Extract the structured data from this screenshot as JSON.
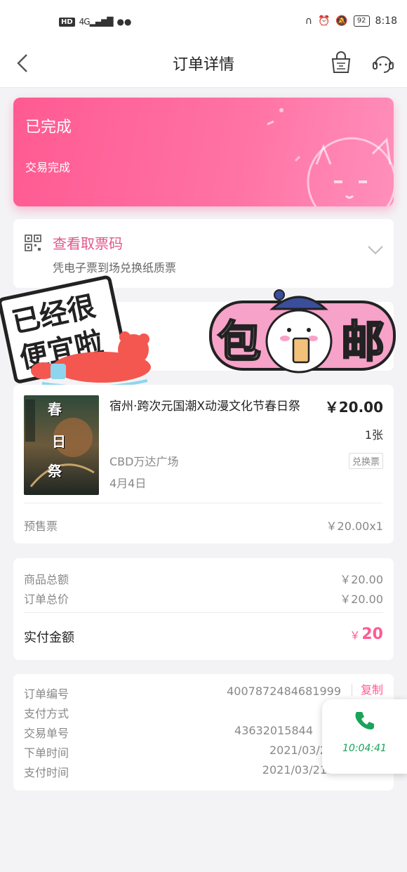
{
  "status_bar": {
    "hd": "HD",
    "network": "4G",
    "battery": "92",
    "time": "8:18"
  },
  "nav": {
    "title": "订单详情"
  },
  "order_status": {
    "title": "已完成",
    "subtitle": "交易完成"
  },
  "ticket": {
    "title": "查看取票码",
    "description": "凭电子票到场兑换纸质票"
  },
  "promo": {
    "left_sticker_line1": "已经很",
    "left_sticker_line2": "便宜啦",
    "right_sticker_char1": "包",
    "right_sticker_char2": "邮"
  },
  "product": {
    "name": "宿州·跨次元国潮X动漫文化节春日祭",
    "price": "￥20.00",
    "quantity": "1张",
    "venue": "CBD万达广场",
    "badge": "兑换票",
    "date": "4月4日",
    "ticket_type": "预售票",
    "unit_price": "￥20.00x1",
    "poster_text": [
      "春",
      "日",
      "祭"
    ]
  },
  "amounts": {
    "goods_total_label": "商品总额",
    "goods_total_value": "￥20.00",
    "order_total_label": "订单总价",
    "order_total_value": "￥20.00",
    "paid_label": "实付金额",
    "paid_currency": "￥",
    "paid_value": "20"
  },
  "order_info": {
    "order_no_label": "订单编号",
    "order_no_value": "4007872484681999",
    "copy_label": "复制",
    "pay_method_label": "支付方式",
    "trade_no_label": "交易单号",
    "trade_no_value": "43632015844",
    "order_time_label": "下单时间",
    "order_time_value": "2021/03/2",
    "pay_time_label": "支付时间",
    "pay_time_value": "2021/03/21"
  },
  "call_widget": {
    "time": "10:04:41"
  },
  "colors": {
    "accent": "#ff5a92",
    "ticket_title": "#e0578a",
    "call_green": "#1aa35a"
  }
}
